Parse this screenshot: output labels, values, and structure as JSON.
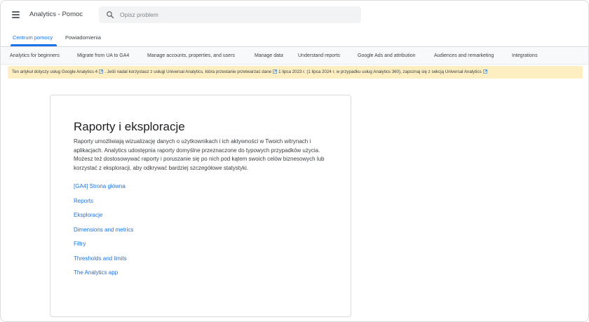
{
  "header": {
    "app_title": "Analytics - Pomoc",
    "search_placeholder": "Opisz problem"
  },
  "tabs": [
    {
      "label": "Centrum pomocy",
      "active": true
    },
    {
      "label": "Powiadomienia",
      "active": false
    }
  ],
  "topics": [
    "Analytics for beginners",
    "Migrate from UA to GA4",
    "Manage accounts, properties, and users",
    "Manage data",
    "Understand reports",
    "Google Ads and attribution",
    "Audiences and remarketing",
    "Integrations"
  ],
  "notice": {
    "part1": "Ten artykuł dotyczy usług Google Analytics 4",
    "part2": ". Jeśli nadal korzystasz z usługi Universal Analytics, która przestanie przetwarzać dane",
    "part3": "1 lipca 2023 r. (1 lipca 2024 r. w przypadku usług Analytics 360), zapoznaj się z sekcją Universal Analytics"
  },
  "card": {
    "title": "Raporty i eksploracje",
    "description": "Raporty umożliwiają wizualizację danych o użytkownikach i ich aktywności w Twoich witrynach i aplikacjach. Analytics udostępnia raporty domyślne przeznaczone do typowych przypadków użycia. Możesz też dostosowywać raporty i poruszanie się po nich pod kątem swoich celów biznesowych lub korzystać z eksploracji, aby odkrywać bardziej szczegółowe statystyki.",
    "links": [
      "[GA4] Strona główna",
      "Reports",
      "Eksploracje",
      "Dimensions and metrics",
      "Filtry",
      "Thresholds and limits",
      "The Analytics app"
    ]
  },
  "colors": {
    "accent": "#1a73e8",
    "notice_bg": "#feefc3"
  }
}
